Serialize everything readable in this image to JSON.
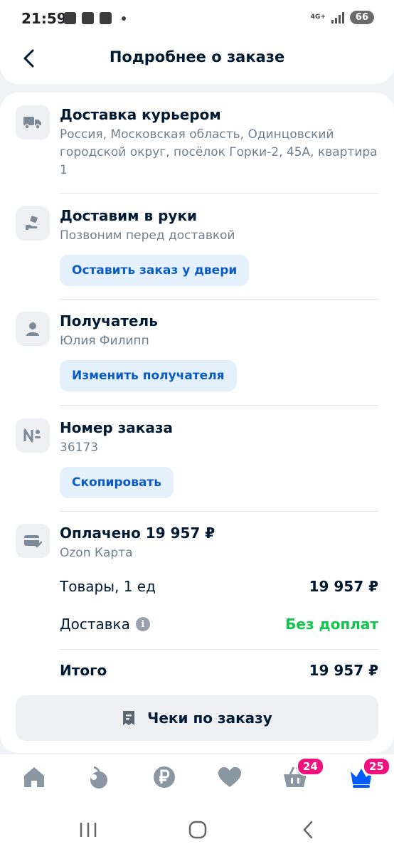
{
  "status_bar": {
    "time": "21:59",
    "network": "4G+",
    "battery": "66"
  },
  "header": {
    "title": "Подробнее о заказе",
    "back_icon": "chevron-left-icon"
  },
  "delivery": {
    "title": "Доставка курьером",
    "address": "Россия, Московская область, Одинцовский городской округ, посёлок Горки-2, 45А, квартира 1",
    "icon": "truck-icon"
  },
  "handover": {
    "title": "Доставим в руки",
    "subtitle": "Позвоним перед доставкой",
    "button": "Оставить заказ у двери",
    "icon": "hand-box-icon"
  },
  "recipient": {
    "title": "Получатель",
    "name": "Юлия Филипп",
    "button": "Изменить получателя",
    "icon": "person-icon"
  },
  "order_number": {
    "title": "Номер заказа",
    "value": "36173",
    "button": "Скопировать",
    "icon": "number-sign-icon"
  },
  "payment": {
    "title": "Оплачено 19 957 ₽",
    "method": "Ozon Карта",
    "goods_label": "Товары, 1 ед",
    "goods_value": "19 957 ₽",
    "delivery_label": "Доставка",
    "delivery_value": "Без доплат",
    "total_label": "Итого",
    "total_value": "19 957 ₽",
    "icon": "card-check-icon"
  },
  "receipts_button": "Чеки по заказу",
  "bottom_nav": {
    "cart_badge": "24",
    "profile_badge": "25"
  },
  "colors": {
    "accent": "#0a5bc4",
    "pill_bg": "#e5f0fd",
    "green": "#10c44c",
    "badge": "#f1117e"
  }
}
